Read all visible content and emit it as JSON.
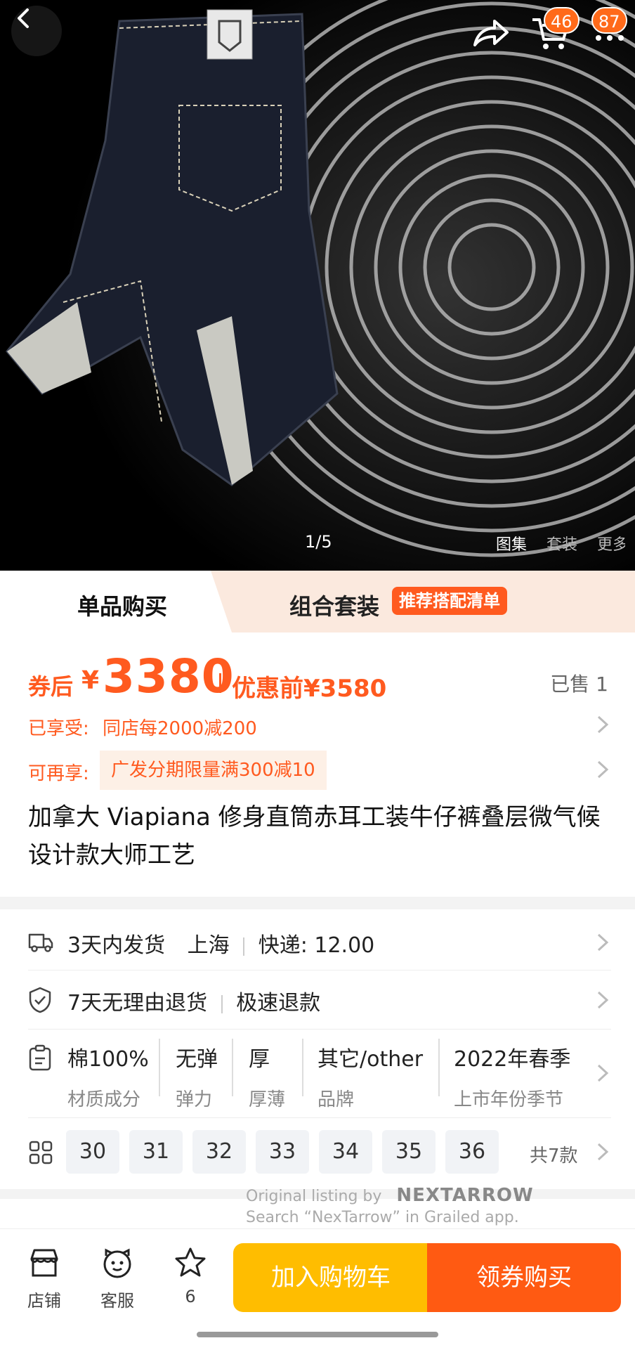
{
  "gallery": {
    "counter": "1/5",
    "tabs": [
      "图集",
      "套装",
      "更多"
    ],
    "cart_badge": "46",
    "msg_badge": "87"
  },
  "mode_tabs": {
    "single": "单品购买",
    "combo": "组合套装",
    "combo_tag": "推荐搭配清单"
  },
  "price": {
    "label": "券后",
    "currency": "¥",
    "value": "3380",
    "original": "优惠前¥3580",
    "sold": "已售 1"
  },
  "promos": [
    {
      "key": "已享受:",
      "value": "同店每2000减200"
    },
    {
      "key": "可再享:",
      "value": "广发分期限量满300减10"
    }
  ],
  "title": "加拿大 Viapiana 修身直筒赤耳工装牛仔裤叠层微气候设计款大师工艺",
  "shipping": {
    "time": "3天内发货",
    "origin": "上海",
    "fee": "快递: 12.00"
  },
  "returns": {
    "policy": "7天无理由退货",
    "refund": "极速退款"
  },
  "specs": [
    {
      "value": "棉100%",
      "key": "材质成分"
    },
    {
      "value": "无弹",
      "key": "弹力"
    },
    {
      "value": "厚",
      "key": "厚薄"
    },
    {
      "value": "其它/other",
      "key": "品牌"
    },
    {
      "value": "2022年春季",
      "key": "上市年份季节"
    }
  ],
  "sizes": {
    "options": [
      "30",
      "31",
      "32",
      "33",
      "34",
      "35",
      "36"
    ],
    "total": "共7款"
  },
  "watermark": {
    "line1": "Original listing by",
    "brand": "NEXTARROW",
    "line2": "Search “NexTarrow” in Grailed app."
  },
  "bottom": {
    "shop": "店铺",
    "service": "客服",
    "favorites": "6",
    "add_cart": "加入购物车",
    "buy": "领券购买"
  },
  "colors": {
    "accent": "#ff5a1f",
    "cart_button": "#ffbd00",
    "buy_button": "#ff5a12"
  }
}
